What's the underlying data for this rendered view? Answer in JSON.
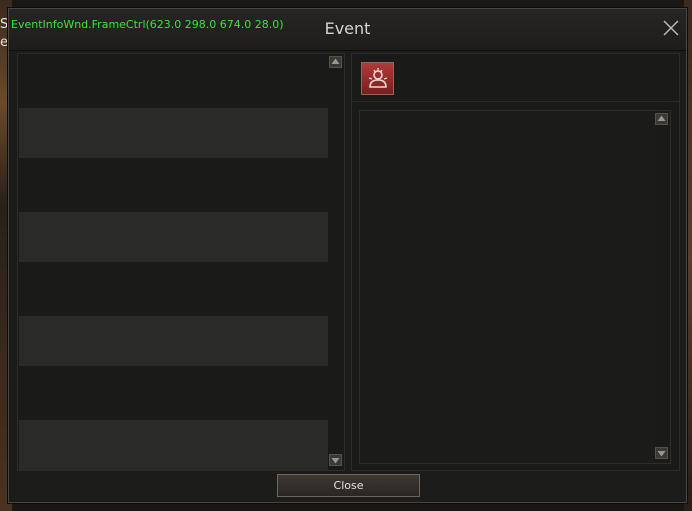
{
  "background": {
    "letter_top": "S",
    "letter_bottom": "er"
  },
  "window": {
    "debug_label": "EventInfoWnd.FrameCtrl(623.0 298.0 674.0 28.0)",
    "title": "Event",
    "close_button_label": "Close"
  },
  "event_list": {
    "items": [
      {},
      {},
      {},
      {}
    ]
  },
  "icons": {
    "close": "close-icon",
    "event": "event-icon",
    "scroll_up": "arrow-up-icon",
    "scroll_down": "arrow-down-icon"
  },
  "colors": {
    "debug_text": "#3ee03e",
    "title_text": "#d8d4cc",
    "icon_red": "#b03a3a"
  }
}
